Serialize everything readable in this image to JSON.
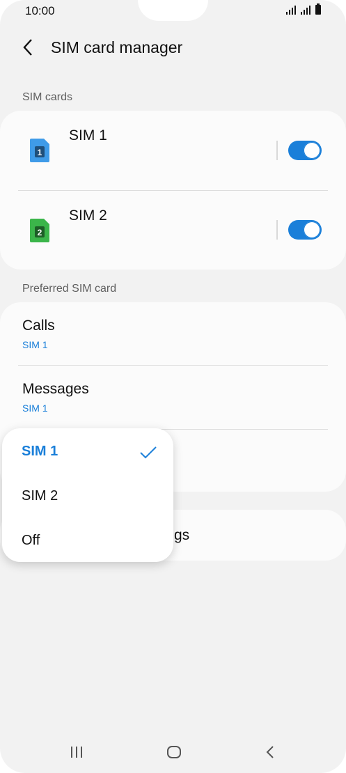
{
  "status": {
    "time": "10:00"
  },
  "header": {
    "title": "SIM card manager"
  },
  "sections": {
    "sim_cards": "SIM cards",
    "preferred": "Preferred SIM card"
  },
  "sims": [
    {
      "name": "SIM 1",
      "badge": "1",
      "color": "#3f9be8",
      "enabled": true
    },
    {
      "name": "SIM 2",
      "badge": "2",
      "color": "#3bb54a",
      "enabled": true
    }
  ],
  "preferred": [
    {
      "title": "Calls",
      "value": "SIM 1"
    },
    {
      "title": "Messages",
      "value": "SIM 1"
    }
  ],
  "partial_row": {
    "text_tail": "gs"
  },
  "dropdown": {
    "options": [
      "SIM 1",
      "SIM 2",
      "Off"
    ],
    "selected": "SIM 1"
  },
  "colors": {
    "accent": "#1a7fd9",
    "background": "#f2f2f2",
    "card": "#fbfbfb"
  },
  "icons": [
    "back-arrow-icon",
    "sim-card-icon",
    "checkmark-icon",
    "recent-apps-icon",
    "home-icon",
    "back-icon"
  ]
}
